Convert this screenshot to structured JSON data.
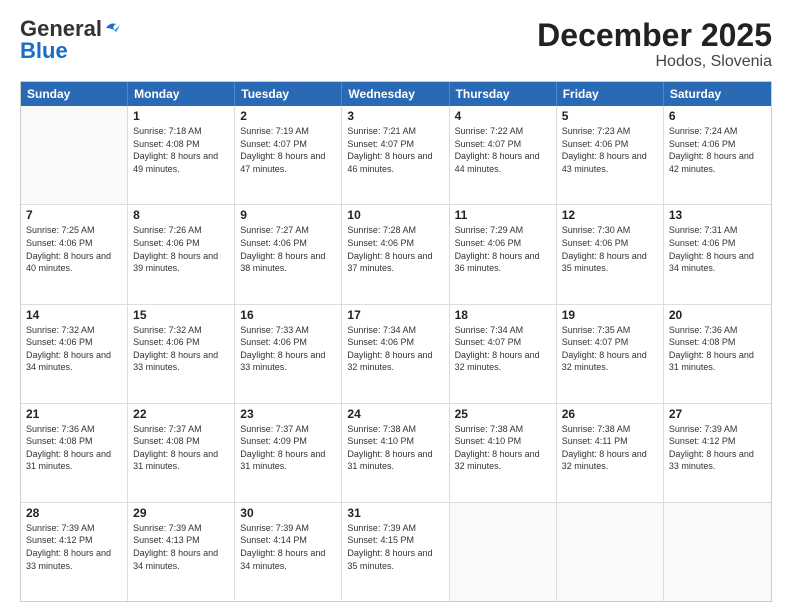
{
  "header": {
    "logo_line1": "General",
    "logo_line2": "Blue",
    "title": "December 2025",
    "subtitle": "Hodos, Slovenia"
  },
  "calendar": {
    "days_of_week": [
      "Sunday",
      "Monday",
      "Tuesday",
      "Wednesday",
      "Thursday",
      "Friday",
      "Saturday"
    ],
    "weeks": [
      [
        {
          "day": "",
          "sunrise": "",
          "sunset": "",
          "daylight": ""
        },
        {
          "day": "1",
          "sunrise": "Sunrise: 7:18 AM",
          "sunset": "Sunset: 4:08 PM",
          "daylight": "Daylight: 8 hours and 49 minutes."
        },
        {
          "day": "2",
          "sunrise": "Sunrise: 7:19 AM",
          "sunset": "Sunset: 4:07 PM",
          "daylight": "Daylight: 8 hours and 47 minutes."
        },
        {
          "day": "3",
          "sunrise": "Sunrise: 7:21 AM",
          "sunset": "Sunset: 4:07 PM",
          "daylight": "Daylight: 8 hours and 46 minutes."
        },
        {
          "day": "4",
          "sunrise": "Sunrise: 7:22 AM",
          "sunset": "Sunset: 4:07 PM",
          "daylight": "Daylight: 8 hours and 44 minutes."
        },
        {
          "day": "5",
          "sunrise": "Sunrise: 7:23 AM",
          "sunset": "Sunset: 4:06 PM",
          "daylight": "Daylight: 8 hours and 43 minutes."
        },
        {
          "day": "6",
          "sunrise": "Sunrise: 7:24 AM",
          "sunset": "Sunset: 4:06 PM",
          "daylight": "Daylight: 8 hours and 42 minutes."
        }
      ],
      [
        {
          "day": "7",
          "sunrise": "Sunrise: 7:25 AM",
          "sunset": "Sunset: 4:06 PM",
          "daylight": "Daylight: 8 hours and 40 minutes."
        },
        {
          "day": "8",
          "sunrise": "Sunrise: 7:26 AM",
          "sunset": "Sunset: 4:06 PM",
          "daylight": "Daylight: 8 hours and 39 minutes."
        },
        {
          "day": "9",
          "sunrise": "Sunrise: 7:27 AM",
          "sunset": "Sunset: 4:06 PM",
          "daylight": "Daylight: 8 hours and 38 minutes."
        },
        {
          "day": "10",
          "sunrise": "Sunrise: 7:28 AM",
          "sunset": "Sunset: 4:06 PM",
          "daylight": "Daylight: 8 hours and 37 minutes."
        },
        {
          "day": "11",
          "sunrise": "Sunrise: 7:29 AM",
          "sunset": "Sunset: 4:06 PM",
          "daylight": "Daylight: 8 hours and 36 minutes."
        },
        {
          "day": "12",
          "sunrise": "Sunrise: 7:30 AM",
          "sunset": "Sunset: 4:06 PM",
          "daylight": "Daylight: 8 hours and 35 minutes."
        },
        {
          "day": "13",
          "sunrise": "Sunrise: 7:31 AM",
          "sunset": "Sunset: 4:06 PM",
          "daylight": "Daylight: 8 hours and 34 minutes."
        }
      ],
      [
        {
          "day": "14",
          "sunrise": "Sunrise: 7:32 AM",
          "sunset": "Sunset: 4:06 PM",
          "daylight": "Daylight: 8 hours and 34 minutes."
        },
        {
          "day": "15",
          "sunrise": "Sunrise: 7:32 AM",
          "sunset": "Sunset: 4:06 PM",
          "daylight": "Daylight: 8 hours and 33 minutes."
        },
        {
          "day": "16",
          "sunrise": "Sunrise: 7:33 AM",
          "sunset": "Sunset: 4:06 PM",
          "daylight": "Daylight: 8 hours and 33 minutes."
        },
        {
          "day": "17",
          "sunrise": "Sunrise: 7:34 AM",
          "sunset": "Sunset: 4:06 PM",
          "daylight": "Daylight: 8 hours and 32 minutes."
        },
        {
          "day": "18",
          "sunrise": "Sunrise: 7:34 AM",
          "sunset": "Sunset: 4:07 PM",
          "daylight": "Daylight: 8 hours and 32 minutes."
        },
        {
          "day": "19",
          "sunrise": "Sunrise: 7:35 AM",
          "sunset": "Sunset: 4:07 PM",
          "daylight": "Daylight: 8 hours and 32 minutes."
        },
        {
          "day": "20",
          "sunrise": "Sunrise: 7:36 AM",
          "sunset": "Sunset: 4:08 PM",
          "daylight": "Daylight: 8 hours and 31 minutes."
        }
      ],
      [
        {
          "day": "21",
          "sunrise": "Sunrise: 7:36 AM",
          "sunset": "Sunset: 4:08 PM",
          "daylight": "Daylight: 8 hours and 31 minutes."
        },
        {
          "day": "22",
          "sunrise": "Sunrise: 7:37 AM",
          "sunset": "Sunset: 4:08 PM",
          "daylight": "Daylight: 8 hours and 31 minutes."
        },
        {
          "day": "23",
          "sunrise": "Sunrise: 7:37 AM",
          "sunset": "Sunset: 4:09 PM",
          "daylight": "Daylight: 8 hours and 31 minutes."
        },
        {
          "day": "24",
          "sunrise": "Sunrise: 7:38 AM",
          "sunset": "Sunset: 4:10 PM",
          "daylight": "Daylight: 8 hours and 31 minutes."
        },
        {
          "day": "25",
          "sunrise": "Sunrise: 7:38 AM",
          "sunset": "Sunset: 4:10 PM",
          "daylight": "Daylight: 8 hours and 32 minutes."
        },
        {
          "day": "26",
          "sunrise": "Sunrise: 7:38 AM",
          "sunset": "Sunset: 4:11 PM",
          "daylight": "Daylight: 8 hours and 32 minutes."
        },
        {
          "day": "27",
          "sunrise": "Sunrise: 7:39 AM",
          "sunset": "Sunset: 4:12 PM",
          "daylight": "Daylight: 8 hours and 33 minutes."
        }
      ],
      [
        {
          "day": "28",
          "sunrise": "Sunrise: 7:39 AM",
          "sunset": "Sunset: 4:12 PM",
          "daylight": "Daylight: 8 hours and 33 minutes."
        },
        {
          "day": "29",
          "sunrise": "Sunrise: 7:39 AM",
          "sunset": "Sunset: 4:13 PM",
          "daylight": "Daylight: 8 hours and 34 minutes."
        },
        {
          "day": "30",
          "sunrise": "Sunrise: 7:39 AM",
          "sunset": "Sunset: 4:14 PM",
          "daylight": "Daylight: 8 hours and 34 minutes."
        },
        {
          "day": "31",
          "sunrise": "Sunrise: 7:39 AM",
          "sunset": "Sunset: 4:15 PM",
          "daylight": "Daylight: 8 hours and 35 minutes."
        },
        {
          "day": "",
          "sunrise": "",
          "sunset": "",
          "daylight": ""
        },
        {
          "day": "",
          "sunrise": "",
          "sunset": "",
          "daylight": ""
        },
        {
          "day": "",
          "sunrise": "",
          "sunset": "",
          "daylight": ""
        }
      ]
    ]
  }
}
